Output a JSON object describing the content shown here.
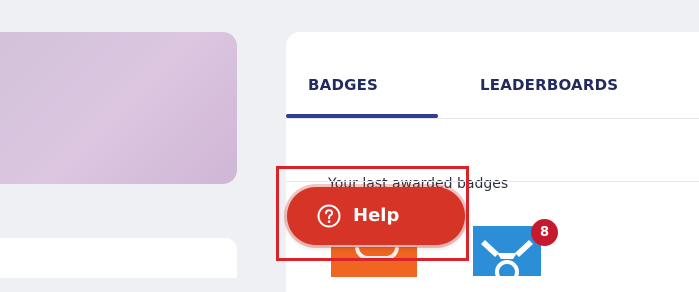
{
  "tabs": [
    {
      "label": "BADGES",
      "active": true
    },
    {
      "label": "LEADERBOARDS",
      "active": false
    }
  ],
  "badges_section": {
    "heading": "Your last awarded badges",
    "items": [
      {
        "icon": "orange-badge-icon",
        "color": "#f06522"
      },
      {
        "icon": "blue-badge-icon",
        "color": "#2b8ed6",
        "count": "8"
      }
    ]
  },
  "help_button": {
    "icon": "question-circle-icon",
    "label": "Help",
    "color": "#d63427"
  },
  "colors": {
    "accent": "#2d3f8e",
    "highlight": "#d8232a",
    "count_badge": "#c5192d"
  }
}
